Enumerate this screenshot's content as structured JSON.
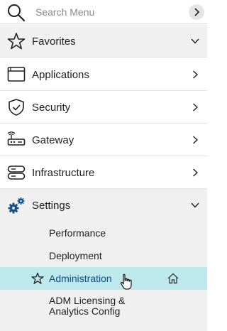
{
  "search": {
    "placeholder": "Search Menu"
  },
  "nav": {
    "favorites": "Favorites",
    "applications": "Applications",
    "security": "Security",
    "gateway": "Gateway",
    "infrastructure": "Infrastructure",
    "settings": "Settings"
  },
  "settings_items": {
    "performance": "Performance",
    "deployment": "Deployment",
    "administration": "Administration",
    "adm_licensing_line1": "ADM Licensing &",
    "adm_licensing_line2": "Analytics Config"
  },
  "colors": {
    "active_bg": "#bde8ec",
    "accent": "#0d4f86",
    "section_bg": "#f0f0f0"
  },
  "icons": [
    "search-icon",
    "chevron-right-icon",
    "star-icon",
    "window-icon",
    "shield-icon",
    "gateway-icon",
    "server-icon",
    "gears-icon",
    "home-icon",
    "hand-cursor-icon"
  ]
}
